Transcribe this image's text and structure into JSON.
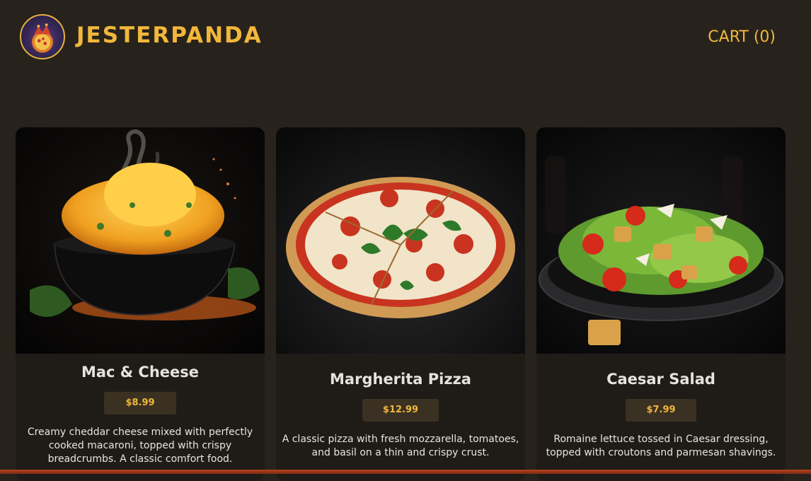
{
  "header": {
    "brand": "JESTERPANDA",
    "cart_label": "CART (0)"
  },
  "products": [
    {
      "name": "Mac & Cheese",
      "price": "$8.99",
      "description": "Creamy cheddar cheese mixed with perfectly cooked macaroni, topped with crispy breadcrumbs. A classic comfort food.",
      "image_icon": "mac-and-cheese-photo"
    },
    {
      "name": "Margherita Pizza",
      "price": "$12.99",
      "description": "A classic pizza with fresh mozzarella, tomatoes, and basil on a thin and crispy crust.",
      "image_icon": "pizza-photo"
    },
    {
      "name": "Caesar Salad",
      "price": "$7.99",
      "description": "Romaine lettuce tossed in Caesar dressing, topped with croutons and parmesan shavings.",
      "image_icon": "caesar-salad-photo"
    }
  ],
  "colors": {
    "background": "#27231c",
    "accent": "#f2b73b",
    "card": "#1f1c17",
    "price_badge": "#3a3123"
  }
}
